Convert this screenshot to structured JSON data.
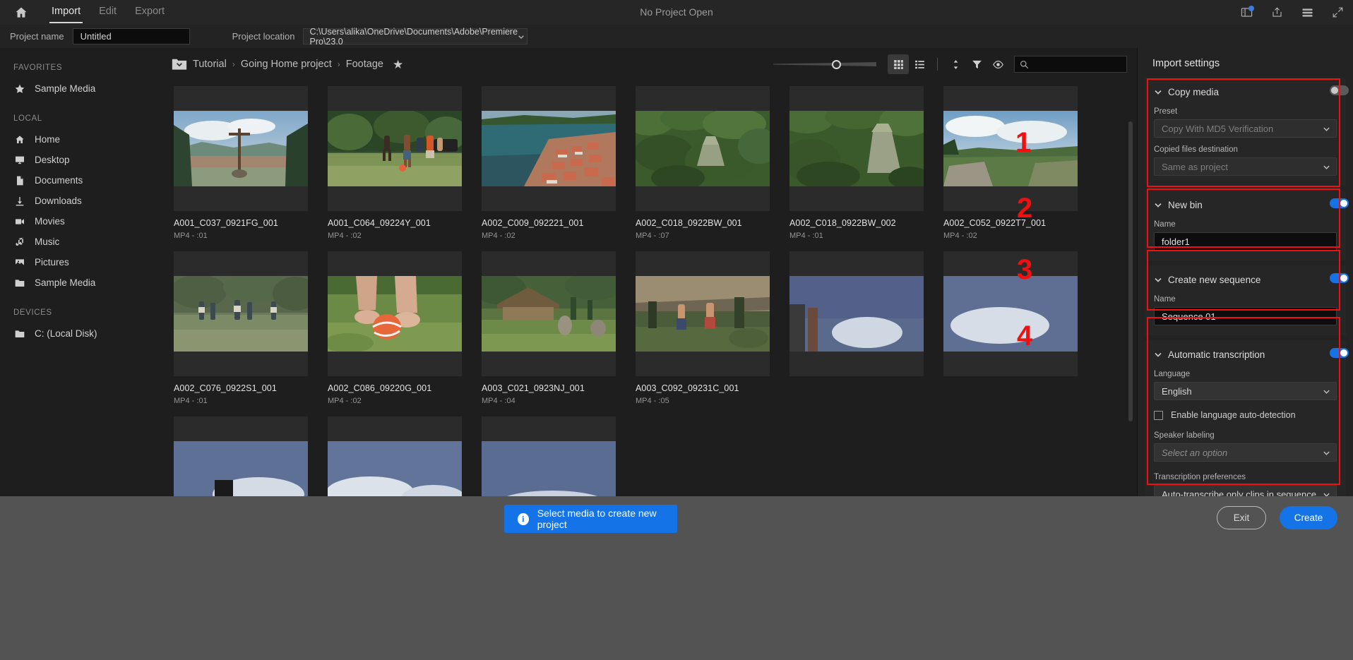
{
  "window": {
    "title": "No Project Open",
    "home_icon": "home-icon",
    "tabs": [
      {
        "label": "Import",
        "active": true
      },
      {
        "label": "Edit",
        "active": false
      },
      {
        "label": "Export",
        "active": false
      }
    ],
    "right_icons": [
      "panel-notification-icon",
      "share-icon",
      "list-menu-icon",
      "fullscreen-icon"
    ]
  },
  "project_row": {
    "name_label": "Project name",
    "name_value": "Untitled",
    "location_label": "Project location",
    "location_value": "C:\\Users\\alika\\OneDrive\\Documents\\Adobe\\Premiere Pro\\23.0"
  },
  "sidebar": {
    "groups": [
      {
        "title": "FAVORITES",
        "items": [
          {
            "label": "Sample Media",
            "icon": "star-icon"
          }
        ]
      },
      {
        "title": "LOCAL",
        "items": [
          {
            "label": "Home",
            "icon": "home-icon"
          },
          {
            "label": "Desktop",
            "icon": "monitor-icon"
          },
          {
            "label": "Documents",
            "icon": "document-icon"
          },
          {
            "label": "Downloads",
            "icon": "download-icon"
          },
          {
            "label": "Movies",
            "icon": "video-camera-icon"
          },
          {
            "label": "Music",
            "icon": "music-note-icon"
          },
          {
            "label": "Pictures",
            "icon": "picture-icon"
          }
        ]
      },
      {
        "title": "DEVICES",
        "items": [
          {
            "label": "C: (Local Disk)",
            "icon": "folder-icon"
          }
        ]
      }
    ],
    "local_extra_item": {
      "label": "Sample Media",
      "icon": "folder-icon"
    }
  },
  "browser": {
    "breadcrumb": [
      "Tutorial",
      "Going Home project",
      "Footage"
    ],
    "breadcrumb_separator": "›",
    "folder_icon": "folder-dropdown-icon",
    "favorite_icon": "star-icon",
    "toolbar": {
      "zoom_slider": "thumbnail-size-slider",
      "grid_view": "grid-view-icon",
      "list_view": "list-view-icon",
      "sort": "sort-icon",
      "filter": "filter-icon",
      "preview": "eye-icon",
      "search_placeholder": "",
      "search_value": ""
    },
    "media": [
      {
        "name": "A001_C037_0921FG_001",
        "meta": "MP4 - :01"
      },
      {
        "name": "A001_C064_09224Y_001",
        "meta": "MP4 - :02"
      },
      {
        "name": "A002_C009_092221_001",
        "meta": "MP4 - :02"
      },
      {
        "name": "A002_C018_0922BW_001",
        "meta": "MP4 - :07"
      },
      {
        "name": "A002_C018_0922BW_002",
        "meta": "MP4 - :01"
      },
      {
        "name": "A002_C052_0922T7_001",
        "meta": "MP4 - :02"
      },
      {
        "name": "A002_C076_0922S1_001",
        "meta": "MP4 - :01"
      },
      {
        "name": "A002_C086_09220G_001",
        "meta": "MP4 - :02"
      },
      {
        "name": "A003_C021_0923NJ_001",
        "meta": "MP4 - :04"
      },
      {
        "name": "A003_C092_09231C_001",
        "meta": "MP4 - :05"
      }
    ]
  },
  "import_settings": {
    "title": "Import settings",
    "sections": [
      {
        "marker": "1",
        "title": "Copy media",
        "enabled": false,
        "fields": [
          {
            "label": "Preset",
            "value": "Copy With MD5 Verification",
            "type": "select",
            "disabled": true
          },
          {
            "label": "Copied files destination",
            "value": "Same as project",
            "type": "select",
            "disabled": true
          }
        ]
      },
      {
        "marker": "2",
        "title": "New bin",
        "enabled": true,
        "fields": [
          {
            "label": "Name",
            "value": "folder1",
            "type": "text"
          }
        ]
      },
      {
        "marker": "3",
        "title": "Create new sequence",
        "enabled": true,
        "fields": [
          {
            "label": "Name",
            "value": "Sequence 01",
            "type": "text"
          }
        ]
      },
      {
        "marker": "4",
        "title": "Automatic transcription",
        "enabled": true,
        "fields": [
          {
            "label": "Language",
            "value": "English",
            "type": "select"
          },
          {
            "label": "Enable language auto-detection",
            "value": false,
            "type": "checkbox"
          },
          {
            "label": "Speaker labeling",
            "value": "Select an option",
            "type": "select-placeholder"
          },
          {
            "label": "Transcription preferences",
            "value": "Auto-transcribe only clips in sequence",
            "type": "select"
          }
        ]
      }
    ]
  },
  "footer": {
    "cta_label": "Select media to create new project",
    "cta_icon": "info-icon",
    "exit_label": "Exit",
    "create_label": "Create"
  },
  "colors": {
    "accent": "#1473e6",
    "annotation": "#f01010",
    "panel_bg": "#232323",
    "app_bg": "#1e1e1e",
    "footer_bg": "#535353"
  }
}
